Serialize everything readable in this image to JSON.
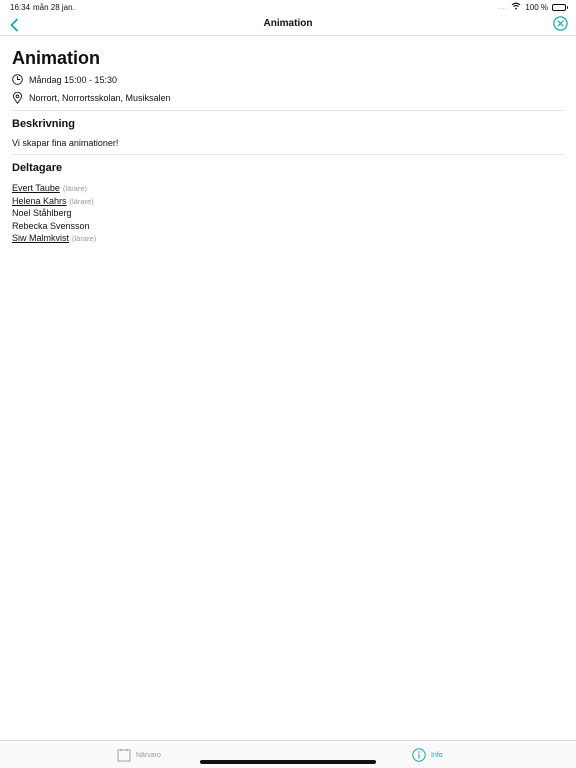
{
  "status_bar": {
    "time": "16:34",
    "date": "mån 28 jan.",
    "dots": "....",
    "battery": "100 %"
  },
  "nav": {
    "title": "Animation"
  },
  "event": {
    "title": "Animation",
    "time": "Måndag 15:00 - 15:30",
    "location": "Norrort, Norrortsskolan, Musiksalen"
  },
  "description": {
    "heading": "Beskrivning",
    "text": "Vi skapar fina animationer!"
  },
  "participants": {
    "heading": "Deltagare",
    "items": [
      {
        "name": "Evert Taube",
        "role": "(lärare)"
      },
      {
        "name": "Helena Kahrs",
        "role": "(lärare)"
      },
      {
        "name": "Noel Ståhlberg",
        "role": ""
      },
      {
        "name": "Rebecka Svensson",
        "role": ""
      },
      {
        "name": "Siw Malmkvist",
        "role": "(lärare)"
      }
    ]
  },
  "tabs": {
    "narvaro": "Närvaro",
    "info": "Info"
  },
  "colors": {
    "accent": "#19a3b0",
    "inactive": "#999999"
  }
}
